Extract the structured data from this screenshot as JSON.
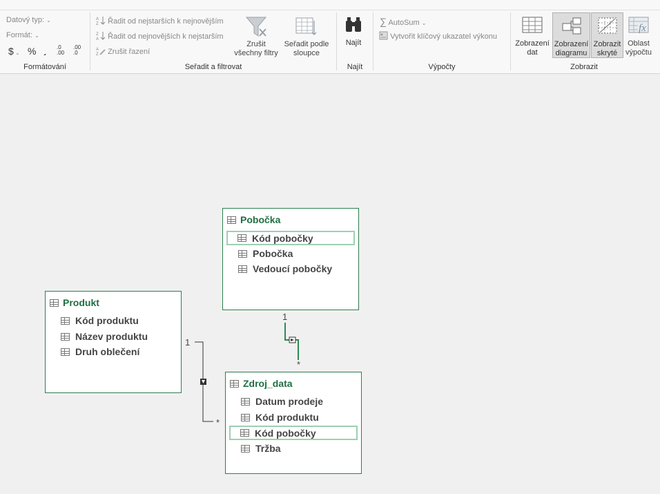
{
  "ribbon": {
    "formatting": {
      "data_type": "Datový typ:",
      "format": "Formát:",
      "currency": "$",
      "percent": "%",
      "comma": "͵",
      "inc_dec": ".0\n.00",
      "dec_dec": ".00\n.0",
      "label": "Formátování"
    },
    "sort_filter": {
      "sort_asc": "Řadit od nejstarších k nejnovějším",
      "sort_desc": "Řadit od nejnovějších k nejstarším",
      "clear_sort": "Zrušit řazení",
      "clear_filters": "Zrušit všechny filtry",
      "sort_by_column": "Seřadit podle sloupce",
      "label": "Seřadit a filtrovat"
    },
    "find": {
      "find_btn": "Najít",
      "label": "Najít"
    },
    "calculations": {
      "autosum": "AutoSum",
      "kpi": "Vytvořit klíčový ukazatel výkonu",
      "label": "Výpočty"
    },
    "view": {
      "data_view": "Zobrazení dat",
      "diagram_view": "Zobrazení diagramu",
      "show_hidden": "Zobrazit skryté",
      "calc_area": "Oblast výpočtu",
      "label": "Zobrazit"
    }
  },
  "diagram": {
    "tables": [
      {
        "name": "Pobočka",
        "fields": [
          "Kód pobočky",
          "Pobočka",
          "Vedoucí pobočky"
        ]
      },
      {
        "name": "Produkt",
        "fields": [
          "Kód produktu",
          "Název produktu",
          "Druh oblečení"
        ]
      },
      {
        "name": "Zdroj_data",
        "fields": [
          "Datum prodeje",
          "Kód produktu",
          "Kód pobočky",
          "Tržba"
        ]
      }
    ],
    "relations": {
      "one": "1",
      "many": "*"
    }
  }
}
